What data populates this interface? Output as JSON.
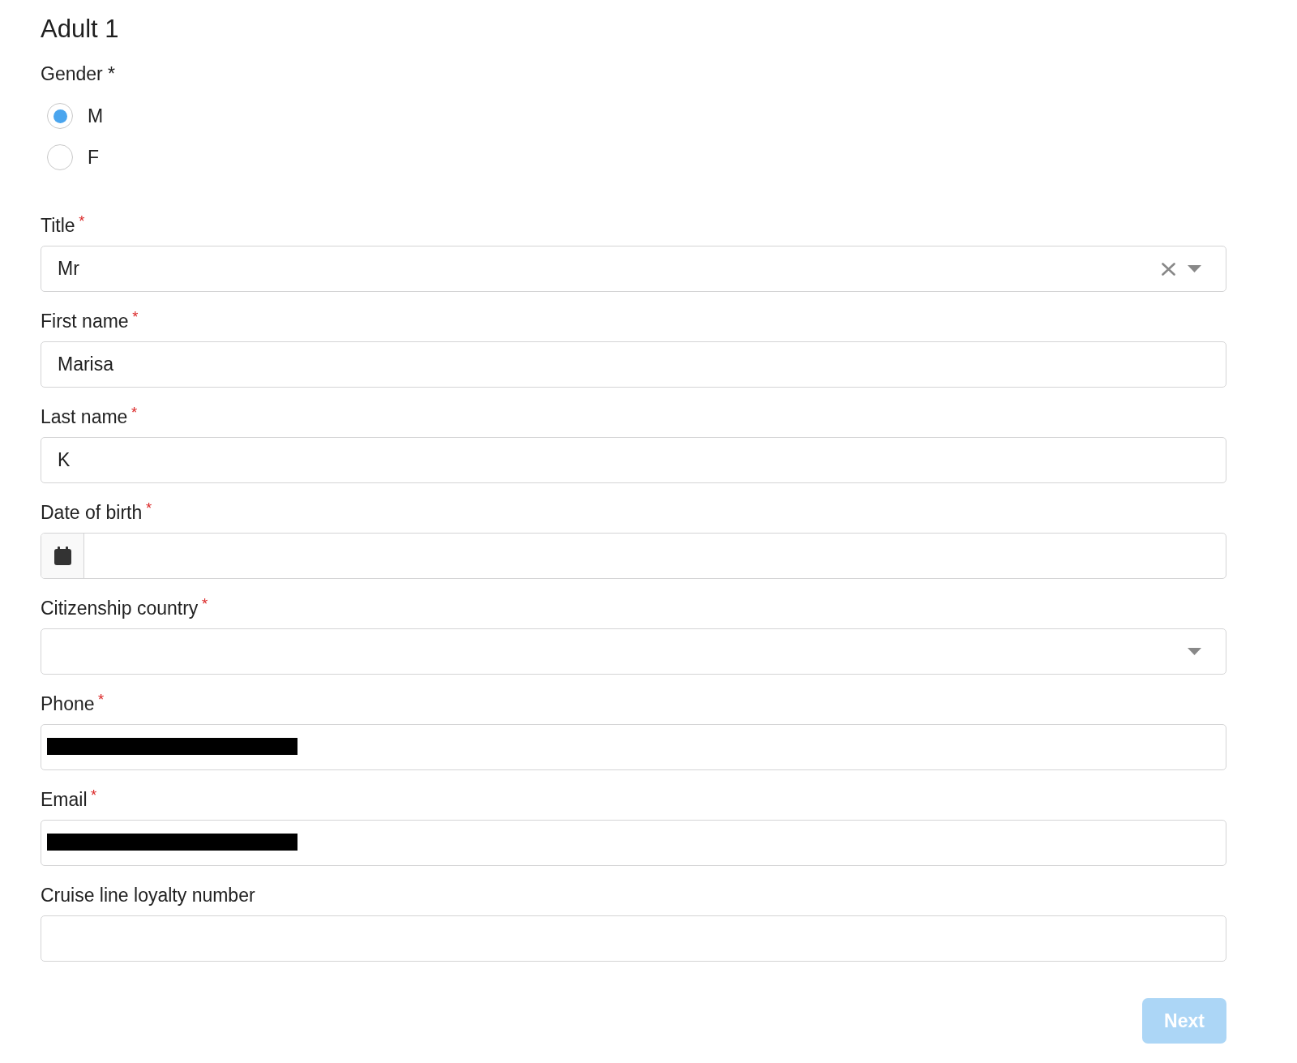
{
  "heading": "Adult 1",
  "gender": {
    "label": "Gender *",
    "options": [
      {
        "label": "M",
        "selected": true
      },
      {
        "label": "F",
        "selected": false
      }
    ]
  },
  "fields": [
    {
      "kind": "select",
      "label": "Title",
      "required_mark": "*",
      "value": "Mr",
      "clearable": true
    },
    {
      "kind": "text",
      "label": "First name",
      "required_mark": "*",
      "value": "Marisa",
      "redacted": false
    },
    {
      "kind": "text",
      "label": "Last name",
      "required_mark": "*",
      "value": "K",
      "redacted": false
    },
    {
      "kind": "date",
      "label": "Date of birth",
      "required_mark": "*"
    },
    {
      "kind": "select",
      "label": "Citizenship country",
      "required_mark": "*",
      "clearable": false
    },
    {
      "kind": "text",
      "label": "Phone",
      "required_mark": "*",
      "redacted": true
    },
    {
      "kind": "text",
      "label": "Email",
      "required_mark": "*",
      "redacted": true
    },
    {
      "kind": "text",
      "label": "Cruise line loyalty number",
      "redacted": false
    }
  ],
  "next_button": {
    "label": "Next",
    "disabled": true
  }
}
